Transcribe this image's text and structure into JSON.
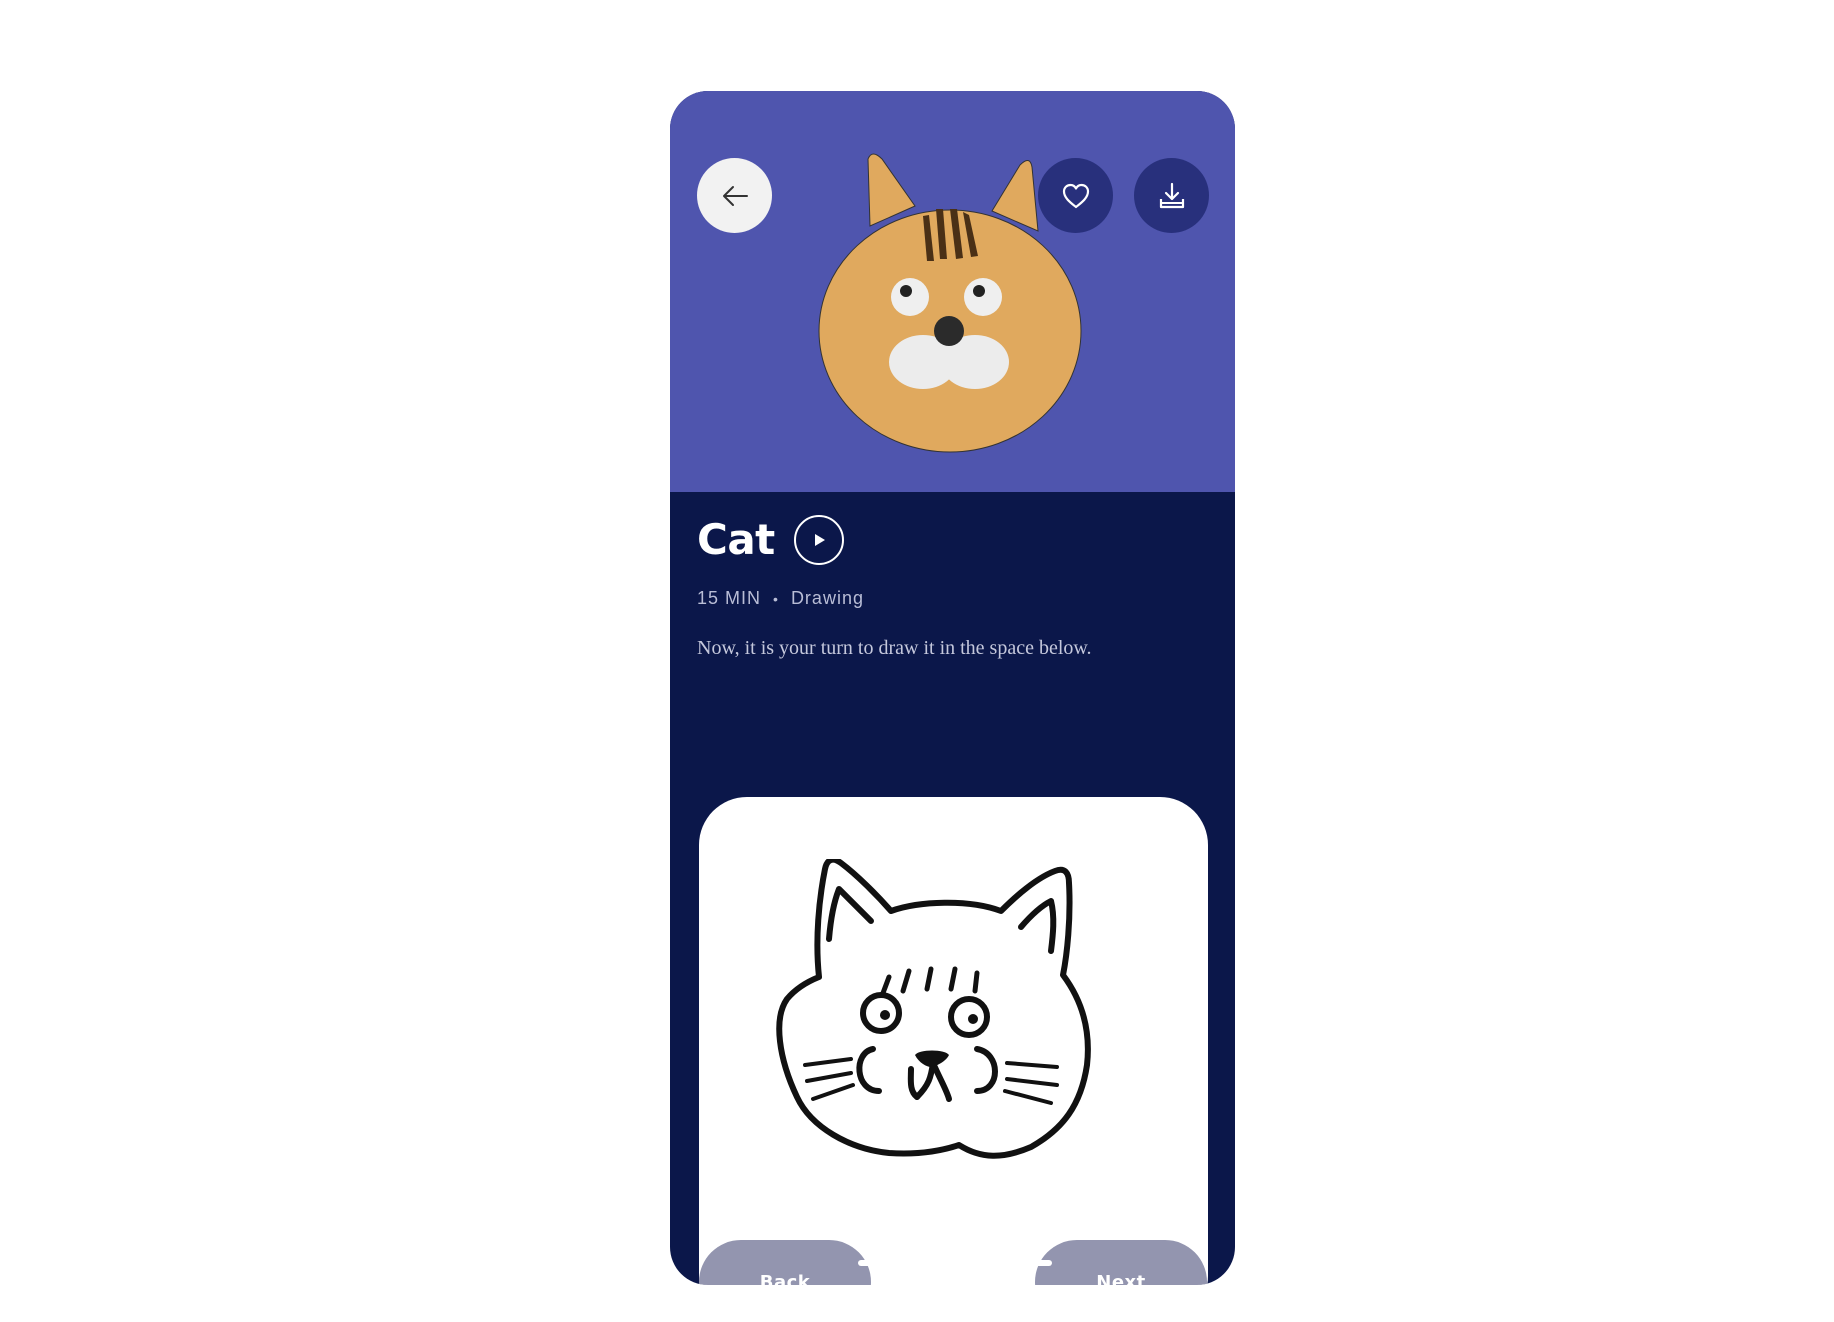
{
  "lesson": {
    "title": "Cat",
    "duration": "15 MIN",
    "category": "Drawing",
    "instruction": "Now, it is your turn to draw it in the space below."
  },
  "buttons": {
    "back": "Back",
    "next": "Next"
  },
  "colors": {
    "hero_background": "#4f55ae",
    "screen_background": "#0b174a",
    "header_button": "#28307c",
    "pill_button": "#9395af",
    "cat_fur": "#e0a95e"
  },
  "icons": {
    "back": "arrow-left-icon",
    "favorite": "heart-icon",
    "download": "download-icon",
    "play": "play-icon"
  }
}
